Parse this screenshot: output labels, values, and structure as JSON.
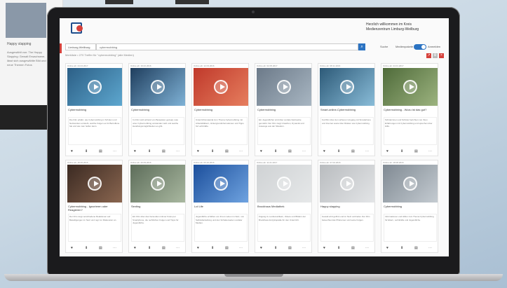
{
  "background_page": {
    "title": "Happy slapping",
    "text": "Ausgewählt von: The Happy Slapping: Gewalt Erwachsene, lässt sich ausgewählte Bild und neue Themen Fotos"
  },
  "app": {
    "org_line1": "Herzlich willkommen im Kreis",
    "org_line2": "Medienzentrum Limburg-Weilburg",
    "search_scope": "Limburg-Weilburg",
    "search_query": "cybermobbing",
    "search_icon": "search-icon",
    "link_suche": "Suche",
    "toggle_label": "Medienpakete",
    "link_anmelden": "Anmelden",
    "breadcrumb": "Merkliste  •  270 Treffer für \"cybermobbing\" (alle Medien)",
    "accent": "#2b73c2",
    "brand_red": "#d6403a"
  },
  "cards": [
    {
      "date": "Online ab: 24.04.2017",
      "title": "Cybermobbing",
      "desc": "Die Film erklärt, wie Cybermobbing in Schulen und Netzwerken entsteht, welche Folgen es für Betroffene hat und wie man helfen kann.",
      "thumb": "#2c5f86",
      "thumb2": "#5da7cf"
    },
    {
      "date": "Online ab: 19.02.2016",
      "title": "Cybermobbing",
      "desc": "Im Film wird anhand von Beispielen gezeigt, was unter Cybermobbing verstanden wird und welche Handlungsmöglichkeiten es gibt.",
      "thumb": "#1f3e5e",
      "thumb2": "#7fb2d6"
    },
    {
      "date": "Online ab: 12.03.2016",
      "title": "Cybermobbing",
      "desc": "Unterrichtsmaterial zum Thema Cybermobbing mit Arbeitsblättern, Hintergrundinformationen und Tipps für Lehrkräfte.",
      "thumb": "#c0392b",
      "thumb2": "#e67e5e"
    },
    {
      "date": "Online ab: 02.05.2017",
      "title": "Cybermobbing",
      "desc": "Ein Jugendlicher wird über soziale Netzwerke gemobbt. Der Film zeigt Ursachen, Dynamik und Auswege aus der Situation.",
      "thumb": "#6c7a89",
      "thumb2": "#a8b6c2"
    },
    {
      "date": "Online ab: 08.11.2016",
      "title": "Smart-online-Cybermobbing",
      "desc": "Kurzfilm über den sicheren Umgang mit Smartphone und Internet sowie über Risiken wie Cybermobbing.",
      "thumb": "#2d5a78",
      "thumb2": "#89bcd8"
    },
    {
      "date": "Online ab: 24.01.2017",
      "title": "Cybermobbing - Wozu ist das gut?",
      "desc": "Schülerinnen und Schüler berichten von ihren Erfahrungen mit Cybermobbing und sprechen über Hilfe.",
      "thumb": "#4f6b3a",
      "thumb2": "#9cb37f"
    },
    {
      "date": "Online ab: 15.06.2016",
      "title": "Cybermobbing - Ignorieren oder Reagieren?",
      "desc": "Der Film zeigt verschiedene Reaktionen auf Beleidigungen im Netz und regt zur Diskussion an.",
      "thumb": "#3b2a22",
      "thumb2": "#8a6650"
    },
    {
      "date": "Online ab: 20.09.2016",
      "title": "Sexting",
      "desc": "Ein Film über das Versenden intimer Fotos per Smartphone, die rechtlichen Folgen und Tipps für Jugendliche.",
      "thumb": "#5d6d5a",
      "thumb2": "#a9b8a0"
    },
    {
      "date": "Online ab: 03.10.2016",
      "title": "Lol Life",
      "desc": "Jugendliche erzählen von ihrem Leben im Netz, von Selbstdarstellung und den Schattenseiten sozialer Medien.",
      "thumb": "#1c4f9c",
      "thumb2": "#6fa3e0"
    },
    {
      "date": "Online ab: 11.01.2017",
      "title": "Brockhaus Mediathek",
      "desc": "Zugang zu Lexikonartikeln, Videos und Bildern der Brockhaus Enzyklopädie für den Unterricht.",
      "thumb": "#cfd2d4",
      "thumb2": "#e6e8e9"
    },
    {
      "date": "Online ab: 27.04.2016",
      "title": "Happy slapping",
      "desc": "Gewalt wird gefilmt und im Netz verbreitet. Der Film beleuchtet das Phänomen und seine Folgen.",
      "thumb": "#b9bcbf",
      "thumb2": "#e3e5e7"
    },
    {
      "date": "Online ab: 18.08.2016",
      "title": "Cybermobbing",
      "desc": "Informationen und Hilfen zum Thema Cybermobbing für Eltern, Lehrkräfte und Jugendliche.",
      "thumb": "#808a93",
      "thumb2": "#c4cbd1"
    }
  ],
  "card_actions": [
    "♥",
    "⬇",
    "▤",
    "⋯"
  ]
}
